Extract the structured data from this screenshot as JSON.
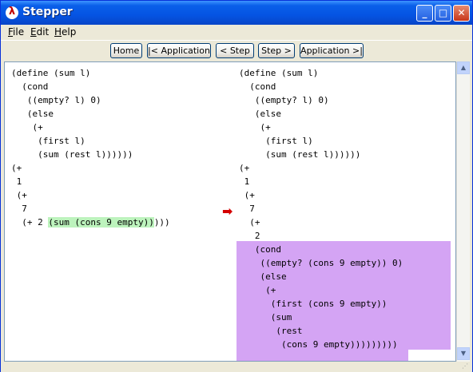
{
  "window": {
    "title": "Stepper"
  },
  "menus": [
    {
      "pre": "",
      "u": "F",
      "post": "ile"
    },
    {
      "pre": "",
      "u": "E",
      "post": "dit"
    },
    {
      "pre": "",
      "u": "H",
      "post": "elp"
    }
  ],
  "toolbar": {
    "home": "Home",
    "prev_app": "|< Application",
    "prev_step": "< Step",
    "next_step": "Step >",
    "next_app": "Application >|"
  },
  "left": {
    "lines": [
      "(define (sum l)",
      "  (cond",
      "   ((empty? l) 0)",
      "   (else",
      "    (+",
      "     (first l)",
      "     (sum (rest l))))))",
      "(+",
      " 1",
      " (+",
      "  7",
      "  (+ 2 "
    ],
    "redex": "(sum (cons 9 empty))",
    "tail": ")))"
  },
  "right": {
    "lines": [
      "(define (sum l)",
      "  (cond",
      "   ((empty? l) 0)",
      "   (else",
      "    (+",
      "     (first l)",
      "     (sum (rest l))))))",
      "(+",
      " 1",
      " (+",
      "  7",
      "  (+",
      "   2"
    ],
    "contractum": [
      "   (cond",
      "    ((empty? (cons 9 empty)) 0)",
      "    (else",
      "     (+",
      "      (first (cons 9 empty))",
      "      (sum",
      "       (rest",
      "        (cons 9 empty)))))))))"
    ]
  },
  "colors": {
    "redex": "#BDF3BD",
    "contractum": "#D4A4F4",
    "arrow": "#D40000"
  },
  "icons": [
    "app-lambda-icon",
    "minimize-icon",
    "maximize-icon",
    "close-icon",
    "step-arrow-icon",
    "scroll-up-icon",
    "scroll-down-icon",
    "resize-grip-icon"
  ]
}
